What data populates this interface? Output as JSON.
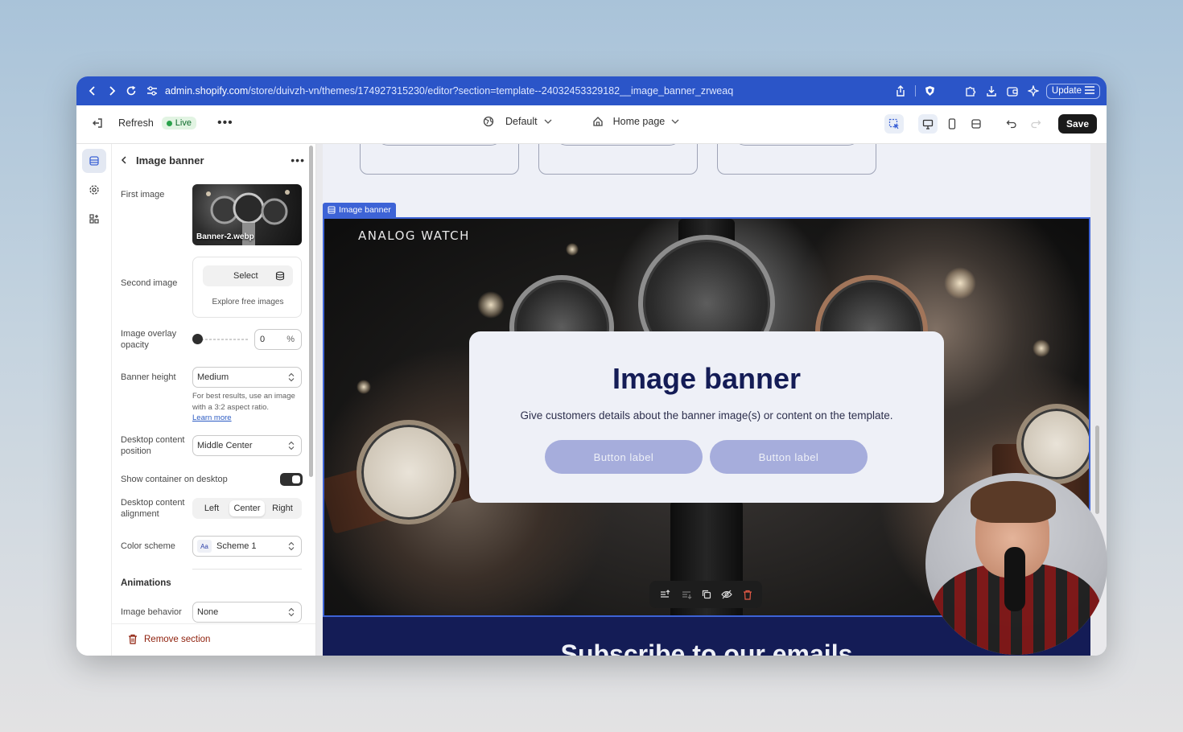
{
  "browser": {
    "url_host": "admin.shopify.com",
    "url_path": "/store/duivzh-vn/themes/174927315230/editor?section=template--24032453329182__image_banner_zrweaq",
    "update_label": "Update"
  },
  "topbar": {
    "refresh_label": "Refresh",
    "live_label": "Live",
    "theme_label": "Default",
    "page_label": "Home page",
    "save_label": "Save"
  },
  "panel": {
    "title": "Image banner",
    "first_image_label": "First image",
    "first_image_filename": "Banner-2.webp",
    "second_image_label": "Second image",
    "select_label": "Select",
    "explore_label": "Explore free images",
    "overlay_label": "Image overlay opacity",
    "overlay_value": "0",
    "overlay_unit": "%",
    "overlay_level": 0,
    "banner_height_label": "Banner height",
    "banner_height_value": "Medium",
    "banner_help": "For best results, use an image with a 3:2 aspect ratio.",
    "learn_more": "Learn more",
    "desktop_position_label": "Desktop content position",
    "desktop_position_value": "Middle Center",
    "show_container_label": "Show container on desktop",
    "show_container_on": true,
    "alignment_label": "Desktop content alignment",
    "alignment_options": [
      "Left",
      "Center",
      "Right"
    ],
    "alignment_selected": "Center",
    "color_scheme_label": "Color scheme",
    "color_scheme_chip": "Aa",
    "color_scheme_value": "Scheme 1",
    "animations_heading": "Animations",
    "image_behavior_label": "Image behavior",
    "image_behavior_value": "None",
    "remove_label": "Remove section"
  },
  "preview": {
    "section_tag": "Image banner",
    "brand_text": "ANALOG WATCH",
    "banner_title": "Image banner",
    "banner_subtitle": "Give customers details about the banner image(s) or content on the template.",
    "button_1": "Button label",
    "button_2": "Button label",
    "subscribe_heading": "Subscribe to our emails"
  },
  "colors": {
    "browser_bar": "#2b55c8",
    "accent_blue": "#3d63d6",
    "banner_title": "#141c56",
    "button_fill": "#a6addc",
    "remove_red": "#8e1f0b"
  },
  "icons": [
    "back-icon",
    "forward-icon",
    "reload-icon",
    "site-settings-icon",
    "share-icon",
    "brave-shield-icon",
    "extensions-icon",
    "download-icon",
    "wallet-icon",
    "leo-icon",
    "menu-icon",
    "exit-icon",
    "globe-icon",
    "chevron-down-icon",
    "home-icon",
    "inspector-icon",
    "desktop-icon",
    "mobile-icon",
    "fullscreen-icon",
    "undo-icon",
    "redo-icon",
    "sections-icon",
    "settings-icon",
    "apps-icon",
    "chevron-left-icon",
    "stack-icon",
    "select-arrows-icon",
    "trash-icon"
  ]
}
